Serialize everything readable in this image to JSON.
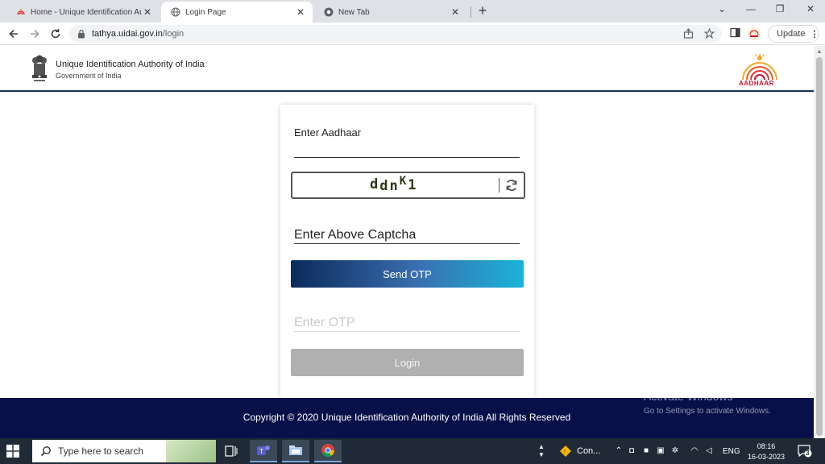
{
  "browser": {
    "tabs": [
      {
        "label": "Home - Unique Identification Au",
        "active": false
      },
      {
        "label": "Login Page",
        "active": true
      },
      {
        "label": "New Tab",
        "active": false
      }
    ],
    "new_tab_symbol": "+",
    "window_controls": {
      "minimize": "⌄",
      "restore": "❐",
      "close": "✕",
      "collapse": "—"
    },
    "url_host": "tathya.uidai.gov.in",
    "url_path": "/login",
    "update_label": "Update"
  },
  "header": {
    "org_name": "Unique Identification Authority of India",
    "org_sub": "Government of India",
    "logo_text": "AADHAAR"
  },
  "form": {
    "aadhaar_label": "Enter Aadhaar",
    "captcha_text": "ddnK1",
    "captcha_parts": [
      "d",
      "d",
      "n",
      "K",
      "1"
    ],
    "captcha_placeholder": "Enter Above Captcha",
    "send_otp_label": "Send OTP",
    "otp_placeholder": "Enter OTP",
    "login_label": "Login"
  },
  "footer": {
    "copyright": "Copyright © 2020 Unique Identification Authority of India All Rights Reserved"
  },
  "watermark": {
    "title": "Activate Windows",
    "subtitle": "Go to Settings to activate Windows."
  },
  "taskbar": {
    "search_placeholder": "Type here to search",
    "tray_app_label": "Con...",
    "language": "ENG",
    "time": "08:16",
    "date": "16-03-2023",
    "notification_count": "3"
  },
  "colors": {
    "header_rule": "#1a2a5c",
    "footer_bg": "#08104a",
    "send_otp_gradient_start": "#0b2a5c",
    "send_otp_gradient_end": "#1ab3d8",
    "login_disabled": "#b0b0b0"
  }
}
